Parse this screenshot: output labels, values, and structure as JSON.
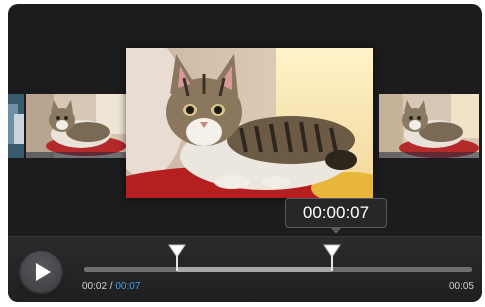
{
  "player": {
    "bubble_time": "00:00:07",
    "current_time": "00:02",
    "separator": " / ",
    "selected_time": "00:07",
    "total_time": "00:05",
    "trim_start_fraction": 0.24,
    "trim_end_fraction": 0.64
  },
  "icons": {
    "play": "play-icon",
    "trim_start": "trim-handle-icon",
    "trim_end": "trim-handle-icon"
  },
  "colors": {
    "accent_time": "#3aa0e6",
    "background": "#1c1c1e"
  }
}
